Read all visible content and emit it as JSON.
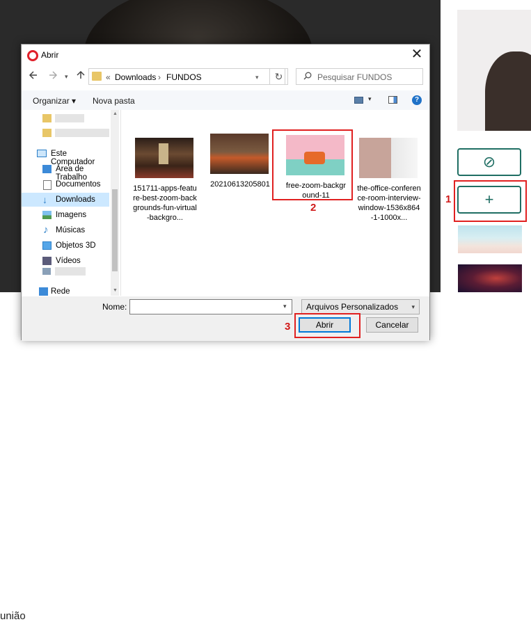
{
  "dialog": {
    "title": "Abrir",
    "close": "✕",
    "breadcrumb": [
      "«",
      "Downloads",
      "›",
      "FUNDOS"
    ],
    "search_placeholder": "Pesquisar FUNDOS",
    "toolbar": {
      "organize": "Organizar ▾",
      "new_folder": "Nova pasta"
    },
    "sidebar": [
      {
        "label": "Este Computador",
        "icon": "computer-icon"
      },
      {
        "label": "Área de Trabalho",
        "icon": "desktop-icon"
      },
      {
        "label": "Documentos",
        "icon": "documents-icon"
      },
      {
        "label": "Downloads",
        "icon": "downloads-icon",
        "selected": true
      },
      {
        "label": "Imagens",
        "icon": "images-icon"
      },
      {
        "label": "Músicas",
        "icon": "music-icon"
      },
      {
        "label": "Objetos 3D",
        "icon": "3d-objects-icon"
      },
      {
        "label": "Vídeos",
        "icon": "videos-icon"
      },
      {
        "label": "Rede",
        "icon": "network-icon"
      }
    ],
    "files": [
      {
        "name": "151711-apps-feature-best-zoom-backgrounds-fun-virtual-backgro..."
      },
      {
        "name": "20210613205801"
      },
      {
        "name": "free-zoom-background-11"
      },
      {
        "name": "the-office-conference-room-interview-window-1536x864-1-1000x..."
      }
    ],
    "footer": {
      "name_label": "Nome:",
      "name_value": "",
      "file_type": "Arquivos Personalizados",
      "open_button": "Abrir",
      "cancel_button": "Cancelar"
    }
  },
  "steps": [
    "1",
    "2",
    "3"
  ],
  "background": {
    "partial_text": "união"
  },
  "side_panel": {
    "block_icon": "⊘",
    "add_icon": "+"
  },
  "colors": {
    "accent": "#1f6e63",
    "highlight": "#e02020",
    "selection": "#cce8ff"
  }
}
